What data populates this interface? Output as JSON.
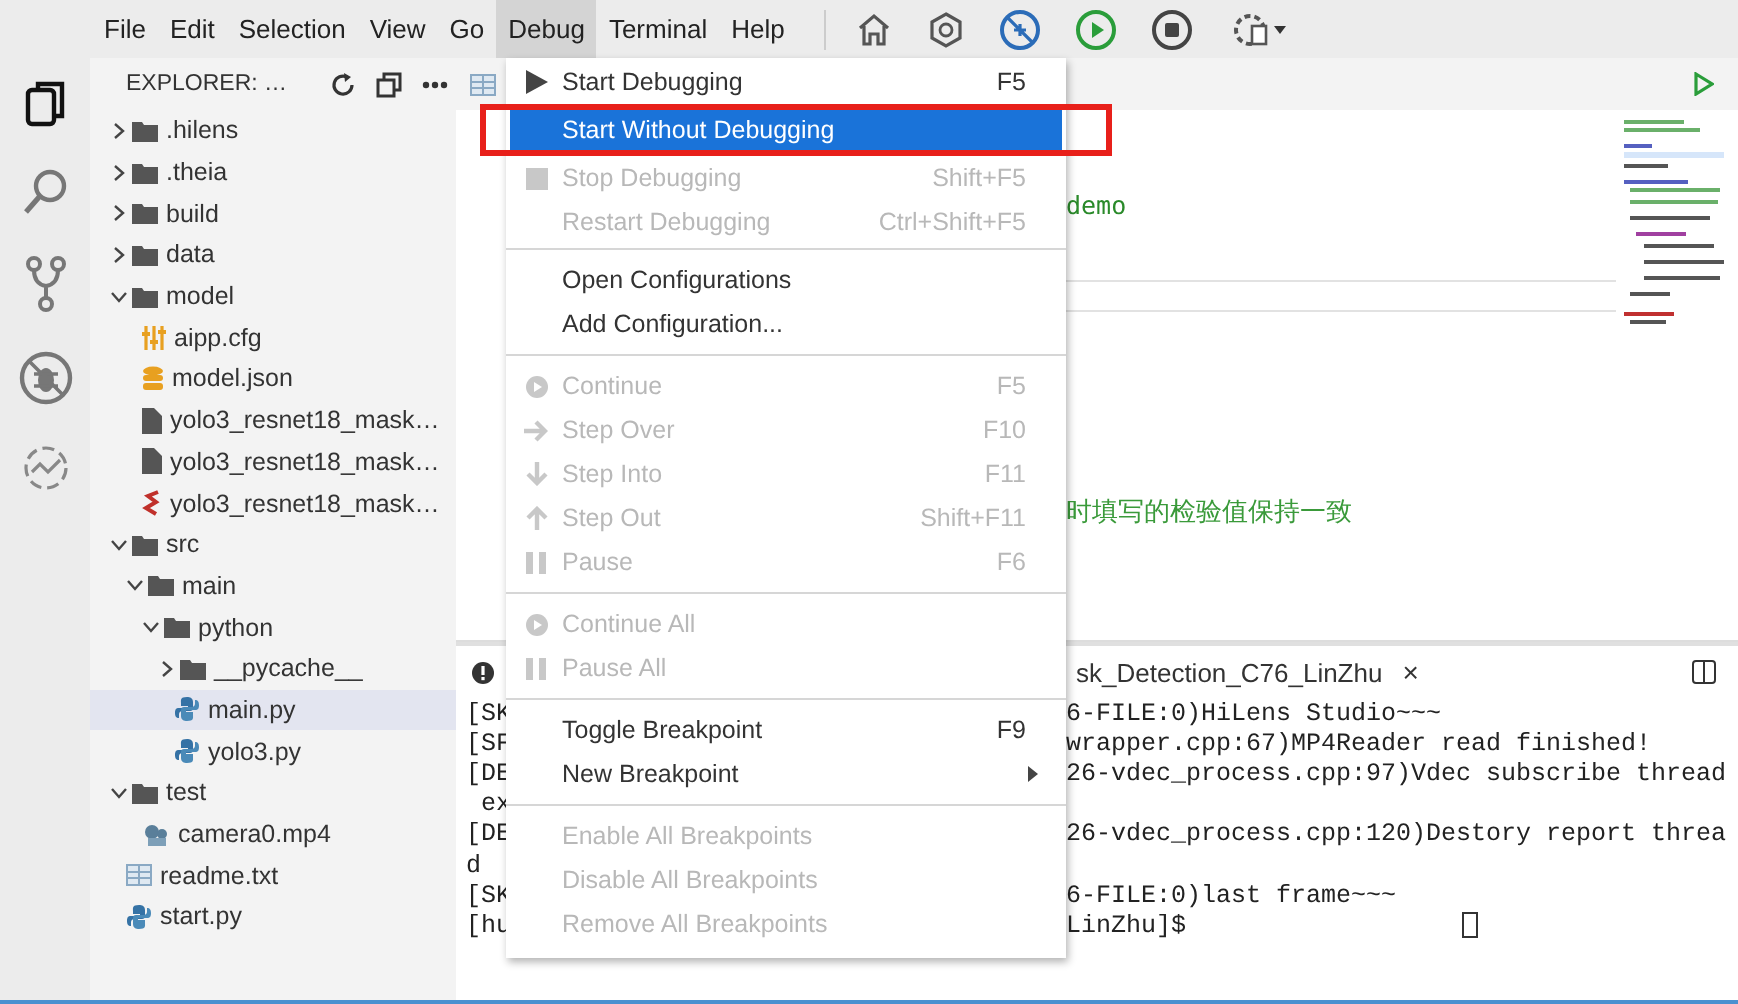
{
  "menubar": [
    {
      "label": "File",
      "selected": false
    },
    {
      "label": "Edit",
      "selected": false
    },
    {
      "label": "Selection",
      "selected": false
    },
    {
      "label": "View",
      "selected": false
    },
    {
      "label": "Go",
      "selected": false
    },
    {
      "label": "Debug",
      "selected": true
    },
    {
      "label": "Terminal",
      "selected": false
    },
    {
      "label": "Help",
      "selected": false
    }
  ],
  "explorer": {
    "title": "EXPLORER: …",
    "tree": [
      {
        "label": ".hilens",
        "kind": "folder",
        "expanded": false,
        "selected": false
      },
      {
        "label": ".theia",
        "kind": "folder",
        "expanded": false,
        "selected": false
      },
      {
        "label": "build",
        "kind": "folder",
        "expanded": false,
        "selected": false
      },
      {
        "label": "data",
        "kind": "folder",
        "expanded": false,
        "selected": false
      },
      {
        "label": "model",
        "kind": "folder",
        "expanded": true,
        "selected": false,
        "children": [
          {
            "label": "aipp.cfg",
            "kind": "config",
            "selected": false
          },
          {
            "label": "model.json",
            "kind": "database",
            "selected": false
          },
          {
            "label": "yolo3_resnet18_mask…",
            "kind": "file",
            "selected": false
          },
          {
            "label": "yolo3_resnet18_mask…",
            "kind": "file",
            "selected": false
          },
          {
            "label": "yolo3_resnet18_mask…",
            "kind": "model",
            "selected": false
          }
        ]
      },
      {
        "label": "src",
        "kind": "folder",
        "expanded": true,
        "selected": false,
        "children": [
          {
            "label": "main",
            "kind": "folder",
            "expanded": true,
            "selected": false,
            "children": [
              {
                "label": "python",
                "kind": "folder",
                "expanded": true,
                "selected": false,
                "children": [
                  {
                    "label": "__pycache__",
                    "kind": "folder",
                    "expanded": false,
                    "selected": false
                  },
                  {
                    "label": "main.py",
                    "kind": "python",
                    "selected": true
                  },
                  {
                    "label": "yolo3.py",
                    "kind": "python",
                    "selected": false
                  }
                ]
              }
            ]
          }
        ]
      },
      {
        "label": "test",
        "kind": "folder",
        "expanded": true,
        "selected": false,
        "children": [
          {
            "label": "camera0.mp4",
            "kind": "video",
            "selected": false
          }
        ]
      },
      {
        "label": "readme.txt",
        "kind": "text",
        "selected": false
      },
      {
        "label": "start.py",
        "kind": "python",
        "selected": false
      }
    ]
  },
  "editor": {
    "code_fragments": [
      "demo",
      "时填写的检验值保持一致"
    ]
  },
  "debug_menu": {
    "sections": [
      [
        {
          "label": "Start Debugging",
          "shortcut": "F5",
          "kind": "start",
          "disabled": false,
          "selected": false
        },
        {
          "label": "Start Without Debugging",
          "kind": "plain",
          "disabled": false,
          "selected": true
        },
        {
          "label": "Stop Debugging",
          "shortcut": "Shift+F5",
          "kind": "stop",
          "disabled": true,
          "selected": false
        },
        {
          "label": "Restart Debugging",
          "shortcut": "Ctrl+Shift+F5",
          "kind": "plain",
          "disabled": true,
          "selected": false
        }
      ],
      [
        {
          "label": "Open Configurations",
          "kind": "plain",
          "disabled": false,
          "selected": false
        },
        {
          "label": "Add Configuration...",
          "kind": "plain",
          "disabled": false,
          "selected": false
        }
      ],
      [
        {
          "label": "Continue",
          "shortcut": "F5",
          "kind": "continue",
          "disabled": true,
          "selected": false
        },
        {
          "label": "Step Over",
          "shortcut": "F10",
          "kind": "step-over",
          "disabled": true,
          "selected": false
        },
        {
          "label": "Step Into",
          "shortcut": "F11",
          "kind": "step-into",
          "disabled": true,
          "selected": false
        },
        {
          "label": "Step Out",
          "shortcut": "Shift+F11",
          "kind": "step-out",
          "disabled": true,
          "selected": false
        },
        {
          "label": "Pause",
          "shortcut": "F6",
          "kind": "pause",
          "disabled": true,
          "selected": false
        }
      ],
      [
        {
          "label": "Continue All",
          "kind": "continue",
          "disabled": true,
          "selected": false
        },
        {
          "label": "Pause All",
          "kind": "pause",
          "disabled": true,
          "selected": false
        }
      ],
      [
        {
          "label": "Toggle Breakpoint",
          "shortcut": "F9",
          "kind": "plain",
          "disabled": false,
          "selected": false
        },
        {
          "label": "New Breakpoint",
          "kind": "submenu",
          "disabled": false,
          "selected": false
        }
      ],
      [
        {
          "label": "Enable All Breakpoints",
          "kind": "plain",
          "disabled": true,
          "selected": false
        },
        {
          "label": "Disable All Breakpoints",
          "kind": "plain",
          "disabled": true,
          "selected": false
        },
        {
          "label": "Remove All Breakpoints",
          "kind": "plain",
          "disabled": true,
          "selected": false
        }
      ]
    ]
  },
  "terminal": {
    "tab_label": "sk_Detection_C76_LinZhu",
    "close": "×",
    "cursor": true,
    "lines": [
      {
        "left": "[SK",
        "right": "6-FILE:0)HiLens Studio~~~"
      },
      {
        "left": "[SF",
        "right": "wrapper.cpp:67)MP4Reader read finished!"
      },
      {
        "left": "[DE",
        "right": "26-vdec_process.cpp:97)Vdec subscribe thread"
      },
      {
        "left": " ex"
      },
      {
        "left": "[DE",
        "right": "26-vdec_process.cpp:120)Destory report threa"
      },
      {
        "left": "d"
      },
      {
        "left": "[SK",
        "right": "6-FILE:0)last frame~~~"
      },
      {
        "left": "[hu",
        "right": "LinZhu]$ "
      }
    ]
  }
}
